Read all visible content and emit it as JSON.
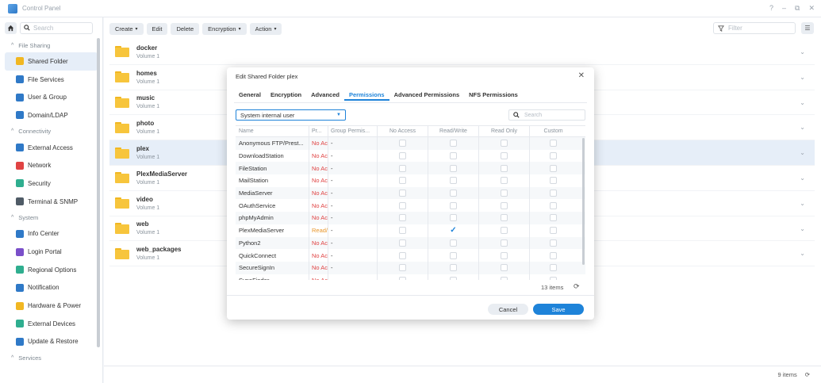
{
  "window": {
    "title": "Control Panel",
    "controls": [
      "?",
      "–",
      "⧉",
      "✕"
    ]
  },
  "sidebar": {
    "search_placeholder": "Search",
    "sections": [
      {
        "label": "File Sharing",
        "items": [
          {
            "label": "Shared Folder",
            "icon": "folder-icon",
            "color": "#f1b722",
            "active": true
          },
          {
            "label": "File Services",
            "icon": "file-services-icon",
            "color": "#2f79c7"
          },
          {
            "label": "User & Group",
            "icon": "user-group-icon",
            "color": "#2f79c7"
          },
          {
            "label": "Domain/LDAP",
            "icon": "domain-icon",
            "color": "#2f79c7"
          }
        ]
      },
      {
        "label": "Connectivity",
        "items": [
          {
            "label": "External Access",
            "icon": "external-access-icon",
            "color": "#2f79c7"
          },
          {
            "label": "Network",
            "icon": "network-icon",
            "color": "#e04343"
          },
          {
            "label": "Security",
            "icon": "security-icon",
            "color": "#2fae8f"
          },
          {
            "label": "Terminal & SNMP",
            "icon": "terminal-icon",
            "color": "#4f5b66"
          }
        ]
      },
      {
        "label": "System",
        "items": [
          {
            "label": "Info Center",
            "icon": "info-icon",
            "color": "#2f79c7"
          },
          {
            "label": "Login Portal",
            "icon": "login-portal-icon",
            "color": "#7a4fc9"
          },
          {
            "label": "Regional Options",
            "icon": "regional-icon",
            "color": "#2fae8f"
          },
          {
            "label": "Notification",
            "icon": "notification-icon",
            "color": "#2f79c7"
          },
          {
            "label": "Hardware & Power",
            "icon": "hardware-icon",
            "color": "#f1b722"
          },
          {
            "label": "External Devices",
            "icon": "external-devices-icon",
            "color": "#2fae8f"
          },
          {
            "label": "Update & Restore",
            "icon": "update-icon",
            "color": "#2f79c7"
          }
        ]
      },
      {
        "label": "Services",
        "items": []
      }
    ]
  },
  "toolbar": {
    "create": "Create",
    "edit": "Edit",
    "delete": "Delete",
    "encryption": "Encryption",
    "action": "Action",
    "filter_placeholder": "Filter"
  },
  "folders": [
    {
      "name": "docker",
      "volume": "Volume 1"
    },
    {
      "name": "homes",
      "volume": "Volume 1"
    },
    {
      "name": "music",
      "volume": "Volume 1"
    },
    {
      "name": "photo",
      "volume": "Volume 1"
    },
    {
      "name": "plex",
      "volume": "Volume 1",
      "selected": true
    },
    {
      "name": "PlexMediaServer",
      "volume": "Volume 1"
    },
    {
      "name": "video",
      "volume": "Volume 1"
    },
    {
      "name": "web",
      "volume": "Volume 1"
    },
    {
      "name": "web_packages",
      "volume": "Volume 1"
    }
  ],
  "status": {
    "count": "9 items"
  },
  "dialog": {
    "title": "Edit Shared Folder plex",
    "tabs": [
      "General",
      "Encryption",
      "Advanced",
      "Permissions",
      "Advanced Permissions",
      "NFS Permissions"
    ],
    "active_tab": "Permissions",
    "select_value": "System internal user",
    "search_placeholder": "Search",
    "columns": [
      "Name",
      "Pr...",
      "Group Permis...",
      "No Access",
      "Read/Write",
      "Read Only",
      "Custom"
    ],
    "rows": [
      {
        "name": "Anonymous FTP/Prest...",
        "preview": "No Ac",
        "group": "-",
        "rw": false
      },
      {
        "name": "DownloadStation",
        "preview": "No Ac",
        "group": "-",
        "rw": false
      },
      {
        "name": "FileStation",
        "preview": "No Ac",
        "group": "-",
        "rw": false
      },
      {
        "name": "MailStation",
        "preview": "No Ac",
        "group": "-",
        "rw": false
      },
      {
        "name": "MediaServer",
        "preview": "No Ac",
        "group": "-",
        "rw": false
      },
      {
        "name": "OAuthService",
        "preview": "No Ac",
        "group": "-",
        "rw": false
      },
      {
        "name": "phpMyAdmin",
        "preview": "No Ac",
        "group": "-",
        "rw": false
      },
      {
        "name": "PlexMediaServer",
        "preview": "Read/",
        "group": "-",
        "rw": true
      },
      {
        "name": "Python2",
        "preview": "No Ac",
        "group": "-",
        "rw": false
      },
      {
        "name": "QuickConnect",
        "preview": "No Ac",
        "group": "-",
        "rw": false
      },
      {
        "name": "SecureSignIn",
        "preview": "No Ac",
        "group": "-",
        "rw": false
      },
      {
        "name": "SynoFinder",
        "preview": "No Ac",
        "group": "-",
        "rw": false
      }
    ],
    "count": "13 items",
    "cancel": "Cancel",
    "save": "Save"
  }
}
